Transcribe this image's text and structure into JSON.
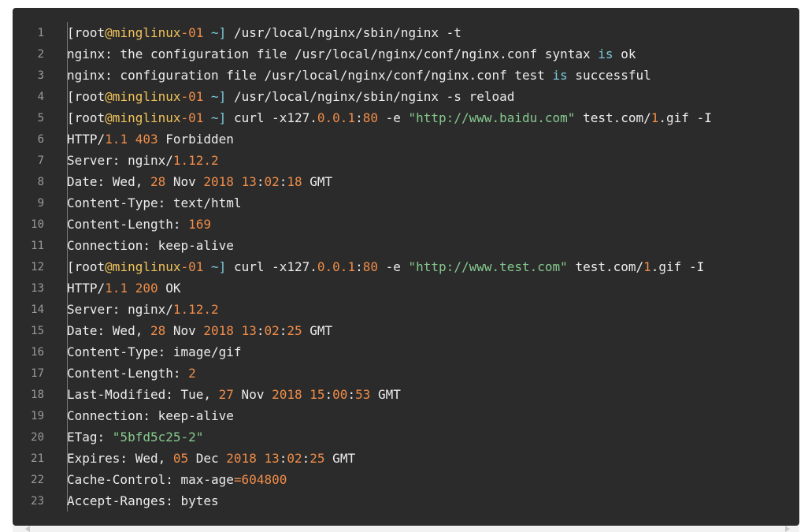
{
  "terminal": {
    "lines": [
      {
        "no": "1",
        "segments": [
          {
            "t": "[root",
            "c": ""
          },
          {
            "t": "@minglinux",
            "c": "t-y"
          },
          {
            "t": "-01",
            "c": "t-o"
          },
          {
            "t": " ~]",
            "c": "t-b"
          },
          {
            "t": " /usr/local/nginx/sbin/nginx -t",
            "c": ""
          }
        ]
      },
      {
        "no": "2",
        "segments": [
          {
            "t": "nginx: the configuration file /usr/local/nginx/conf/nginx.conf syntax ",
            "c": ""
          },
          {
            "t": "is",
            "c": "t-b"
          },
          {
            "t": " ok",
            "c": ""
          }
        ]
      },
      {
        "no": "3",
        "segments": [
          {
            "t": "nginx: configuration file /usr/local/nginx/conf/nginx.conf test ",
            "c": ""
          },
          {
            "t": "is",
            "c": "t-b"
          },
          {
            "t": " successful",
            "c": ""
          }
        ]
      },
      {
        "no": "4",
        "segments": [
          {
            "t": "[root",
            "c": ""
          },
          {
            "t": "@minglinux",
            "c": "t-y"
          },
          {
            "t": "-01",
            "c": "t-o"
          },
          {
            "t": " ~]",
            "c": "t-b"
          },
          {
            "t": " /usr/local/nginx/sbin/nginx -s reload",
            "c": ""
          }
        ]
      },
      {
        "no": "5",
        "segments": [
          {
            "t": "[root",
            "c": ""
          },
          {
            "t": "@minglinux",
            "c": "t-y"
          },
          {
            "t": "-01",
            "c": "t-o"
          },
          {
            "t": " ~]",
            "c": "t-b"
          },
          {
            "t": " curl -x127.",
            "c": ""
          },
          {
            "t": "0.0.1",
            "c": "t-o"
          },
          {
            "t": ":",
            "c": ""
          },
          {
            "t": "80",
            "c": "t-o"
          },
          {
            "t": " -e ",
            "c": ""
          },
          {
            "t": "\"http://www.baidu.com\"",
            "c": "t-g"
          },
          {
            "t": " test.com/",
            "c": ""
          },
          {
            "t": "1",
            "c": "t-o"
          },
          {
            "t": ".gif -I",
            "c": ""
          }
        ]
      },
      {
        "no": "6",
        "segments": [
          {
            "t": "HTTP/",
            "c": ""
          },
          {
            "t": "1.1 403",
            "c": "t-o"
          },
          {
            "t": " Forbidden",
            "c": ""
          }
        ]
      },
      {
        "no": "7",
        "segments": [
          {
            "t": "Server: nginx/",
            "c": ""
          },
          {
            "t": "1.12.2",
            "c": "t-o"
          }
        ]
      },
      {
        "no": "8",
        "segments": [
          {
            "t": "Date: Wed, ",
            "c": ""
          },
          {
            "t": "28",
            "c": "t-o"
          },
          {
            "t": " Nov ",
            "c": ""
          },
          {
            "t": "2018 13",
            "c": "t-o"
          },
          {
            "t": ":",
            "c": ""
          },
          {
            "t": "02",
            "c": "t-o"
          },
          {
            "t": ":",
            "c": ""
          },
          {
            "t": "18",
            "c": "t-o"
          },
          {
            "t": " GMT",
            "c": ""
          }
        ]
      },
      {
        "no": "9",
        "segments": [
          {
            "t": "Content-Type: text/html",
            "c": ""
          }
        ]
      },
      {
        "no": "10",
        "segments": [
          {
            "t": "Content-Length: ",
            "c": ""
          },
          {
            "t": "169",
            "c": "t-o"
          }
        ]
      },
      {
        "no": "11",
        "segments": [
          {
            "t": "Connection: keep-alive",
            "c": ""
          }
        ]
      },
      {
        "no": "12",
        "segments": [
          {
            "t": "[root",
            "c": ""
          },
          {
            "t": "@minglinux",
            "c": "t-y"
          },
          {
            "t": "-01",
            "c": "t-o"
          },
          {
            "t": " ~]",
            "c": "t-b"
          },
          {
            "t": " curl -x127.",
            "c": ""
          },
          {
            "t": "0.0.1",
            "c": "t-o"
          },
          {
            "t": ":",
            "c": ""
          },
          {
            "t": "80",
            "c": "t-o"
          },
          {
            "t": " -e ",
            "c": ""
          },
          {
            "t": "\"http://www.test.com\"",
            "c": "t-g"
          },
          {
            "t": " test.com/",
            "c": ""
          },
          {
            "t": "1",
            "c": "t-o"
          },
          {
            "t": ".gif -I",
            "c": ""
          }
        ]
      },
      {
        "no": "13",
        "segments": [
          {
            "t": "HTTP/",
            "c": ""
          },
          {
            "t": "1.1 200",
            "c": "t-o"
          },
          {
            "t": " OK",
            "c": ""
          }
        ]
      },
      {
        "no": "14",
        "segments": [
          {
            "t": "Server: nginx/",
            "c": ""
          },
          {
            "t": "1.12.2",
            "c": "t-o"
          }
        ]
      },
      {
        "no": "15",
        "segments": [
          {
            "t": "Date: Wed, ",
            "c": ""
          },
          {
            "t": "28",
            "c": "t-o"
          },
          {
            "t": " Nov ",
            "c": ""
          },
          {
            "t": "2018 13",
            "c": "t-o"
          },
          {
            "t": ":",
            "c": ""
          },
          {
            "t": "02",
            "c": "t-o"
          },
          {
            "t": ":",
            "c": ""
          },
          {
            "t": "25",
            "c": "t-o"
          },
          {
            "t": " GMT",
            "c": ""
          }
        ]
      },
      {
        "no": "16",
        "segments": [
          {
            "t": "Content-Type: image/gif",
            "c": ""
          }
        ]
      },
      {
        "no": "17",
        "segments": [
          {
            "t": "Content-Length: ",
            "c": ""
          },
          {
            "t": "2",
            "c": "t-o"
          }
        ]
      },
      {
        "no": "18",
        "segments": [
          {
            "t": "Last-Modified: Tue, ",
            "c": ""
          },
          {
            "t": "27",
            "c": "t-o"
          },
          {
            "t": " Nov ",
            "c": ""
          },
          {
            "t": "2018 15",
            "c": "t-o"
          },
          {
            "t": ":",
            "c": ""
          },
          {
            "t": "00",
            "c": "t-o"
          },
          {
            "t": ":",
            "c": ""
          },
          {
            "t": "53",
            "c": "t-o"
          },
          {
            "t": " GMT",
            "c": ""
          }
        ]
      },
      {
        "no": "19",
        "segments": [
          {
            "t": "Connection: keep-alive",
            "c": ""
          }
        ]
      },
      {
        "no": "20",
        "segments": [
          {
            "t": "ETag: ",
            "c": ""
          },
          {
            "t": "\"5bfd5c25-2\"",
            "c": "t-g"
          }
        ]
      },
      {
        "no": "21",
        "segments": [
          {
            "t": "Expires: Wed, ",
            "c": ""
          },
          {
            "t": "05",
            "c": "t-o"
          },
          {
            "t": " Dec ",
            "c": ""
          },
          {
            "t": "2018 13",
            "c": "t-o"
          },
          {
            "t": ":",
            "c": ""
          },
          {
            "t": "02",
            "c": "t-o"
          },
          {
            "t": ":",
            "c": ""
          },
          {
            "t": "25",
            "c": "t-o"
          },
          {
            "t": " GMT",
            "c": ""
          }
        ]
      },
      {
        "no": "22",
        "segments": [
          {
            "t": "Cache-Control: max-age",
            "c": ""
          },
          {
            "t": "=604800",
            "c": "t-o"
          }
        ]
      },
      {
        "no": "23",
        "segments": [
          {
            "t": "Accept-Ranges: bytes",
            "c": ""
          }
        ]
      }
    ]
  },
  "colors": {
    "background": "#2b2b2b",
    "text": "#ececec",
    "line_number": "#9a9a9a",
    "keyword_yellow": "#f0c35a",
    "number_orange": "#f08d49",
    "string_green": "#86c98e",
    "keyword_cyan": "#7ec9d9"
  }
}
